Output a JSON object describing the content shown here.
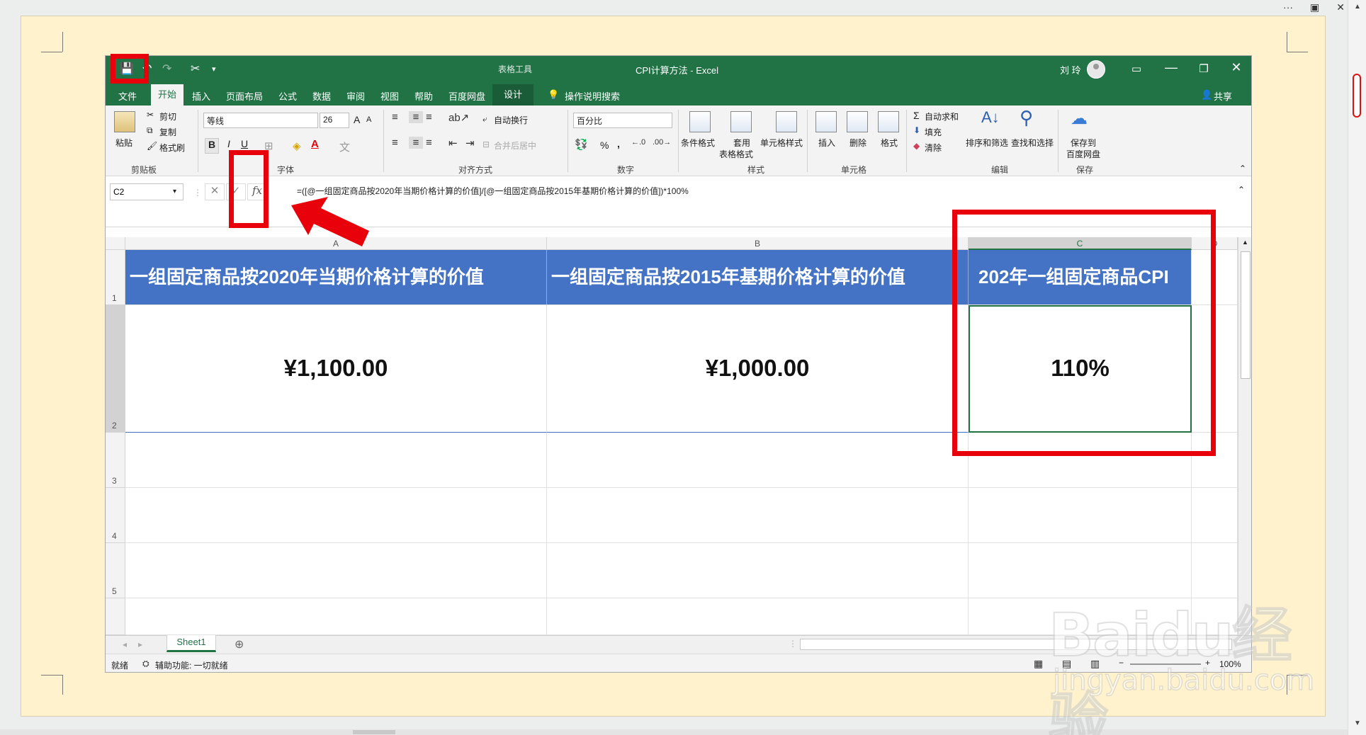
{
  "titlebar": {
    "table_tools": "表格工具",
    "title": "CPI计算方法 - Excel",
    "user": "刘 玲"
  },
  "menubar": {
    "file": "文件",
    "home": "开始",
    "insert": "插入",
    "page_layout": "页面布局",
    "formulas": "公式",
    "data": "数据",
    "review": "审阅",
    "view": "视图",
    "help": "帮助",
    "baidu_disk": "百度网盘",
    "design": "设计",
    "tell_me": "操作说明搜索",
    "share": "共享"
  },
  "ribbon": {
    "clipboard": {
      "paste": "粘贴",
      "cut": "剪切",
      "copy": "复制",
      "format_painter": "格式刷",
      "label": "剪贴板"
    },
    "font": {
      "name": "等线",
      "size": "26",
      "label": "字体",
      "bold": "B",
      "italic": "I",
      "underline": "U",
      "grow": "A",
      "shrink": "A"
    },
    "alignment": {
      "wrap": "自动换行",
      "merge": "合并后居中",
      "label": "对齐方式"
    },
    "number": {
      "format": "百分比",
      "percent": "%",
      "comma": ",",
      "label": "数字"
    },
    "styles": {
      "conditional": "条件格式",
      "table_format_1": "套用",
      "table_format_2": "表格格式",
      "cell_styles": "单元格样式",
      "label": "样式"
    },
    "cells": {
      "insert": "插入",
      "delete": "删除",
      "format": "格式",
      "label": "单元格"
    },
    "editing": {
      "autosum": "自动求和",
      "fill": "填充",
      "clear": "清除",
      "sort_filter": "排序和筛选",
      "find_select": "查找和选择",
      "label": "编辑"
    },
    "save": {
      "save_to_1": "保存到",
      "save_to_2": "百度网盘",
      "label": "保存"
    }
  },
  "formula_bar": {
    "name_box": "C2",
    "fx": "fx",
    "formula": "=([@一组固定商品按2020年当期价格计算的价值]/[@一组固定商品按2015年基期价格计算的价值])*100%"
  },
  "grid": {
    "columns": [
      "A",
      "B",
      "C",
      "D"
    ],
    "rows": [
      "1",
      "2",
      "3",
      "4",
      "5"
    ],
    "headers": [
      "一组固定商品按2020年当期价格计算的价值",
      "一组固定商品按2015年基期价格计算的价值",
      "202年一组固定商品CPI"
    ],
    "values": [
      "¥1,100.00",
      "¥1,000.00",
      "110%"
    ]
  },
  "sheet_tabs": {
    "sheet1": "Sheet1"
  },
  "statusbar": {
    "ready": "就绪",
    "accessibility": "辅助功能: 一切就绪",
    "zoom": "100%"
  },
  "watermark": {
    "logo": "Baidu经验",
    "url": "jingyan.baidu.com"
  },
  "colors": {
    "excel_green": "#217346",
    "header_blue": "#4472c4",
    "annotation_red": "#e8000a",
    "page_cream": "#fff2cc"
  }
}
